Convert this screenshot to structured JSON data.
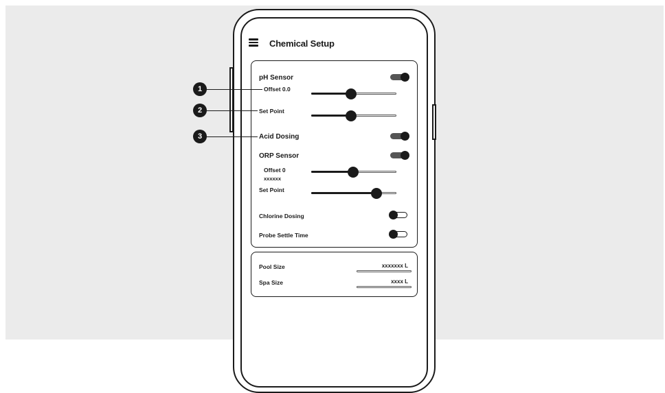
{
  "header": {
    "title": "Chemical Setup",
    "menu_icon": "hamburger-menu-icon"
  },
  "sensors": {
    "ph_sensor": {
      "label": "pH Sensor",
      "enabled": true
    },
    "ph_offset": {
      "label": "Offset 0.0",
      "level_percent": 47
    },
    "ph_set_point": {
      "label": "Set Point",
      "level_percent": 47
    },
    "acid_dosing": {
      "label": "Acid Dosing",
      "enabled": true
    },
    "orp_sensor": {
      "label": "ORP Sensor",
      "enabled": true
    },
    "orp_offset": {
      "label": "Offset 0",
      "sublabel": "xxxxxx",
      "level_percent": 49
    },
    "orp_set_point": {
      "label": "Set Point",
      "level_percent": 77
    },
    "chlorine_dosing": {
      "label": "Chlorine Dosing",
      "enabled": false
    },
    "probe_settle_time": {
      "label": "Probe Settle Time",
      "enabled": false
    }
  },
  "volumes": {
    "pool_size": {
      "label": "Pool Size",
      "value": "xxxxxxx L"
    },
    "spa_size": {
      "label": "Spa Size",
      "value": "xxxx L"
    }
  },
  "callouts": [
    "1",
    "2",
    "3"
  ],
  "colors": {
    "background": "#ebebeb",
    "ink": "#1a1a1a",
    "toggle_on_track": "#555555"
  }
}
